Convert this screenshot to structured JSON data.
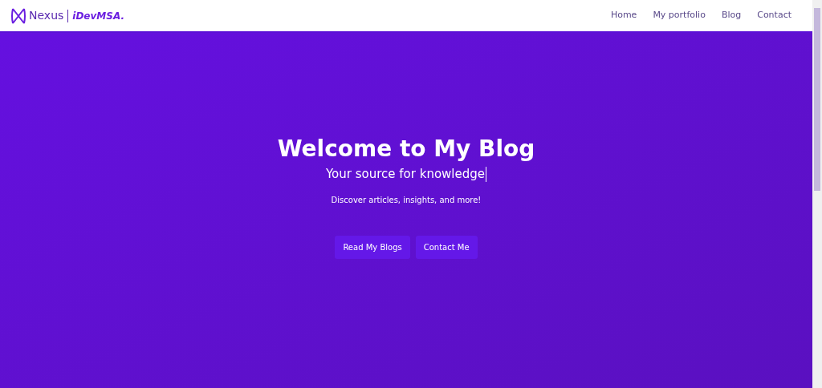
{
  "header": {
    "logo": {
      "name": "Nexus",
      "partner": "iDevMSA."
    },
    "nav": [
      {
        "label": "Home"
      },
      {
        "label": "My portfolio"
      },
      {
        "label": "Blog"
      },
      {
        "label": "Contact"
      }
    ]
  },
  "hero": {
    "title": "Welcome to My Blog",
    "subtitle": "Your source for knowledge",
    "description": "Discover articles, insights, and more!",
    "buttons": [
      {
        "label": "Read My Blogs"
      },
      {
        "label": "Contact Me"
      }
    ]
  }
}
